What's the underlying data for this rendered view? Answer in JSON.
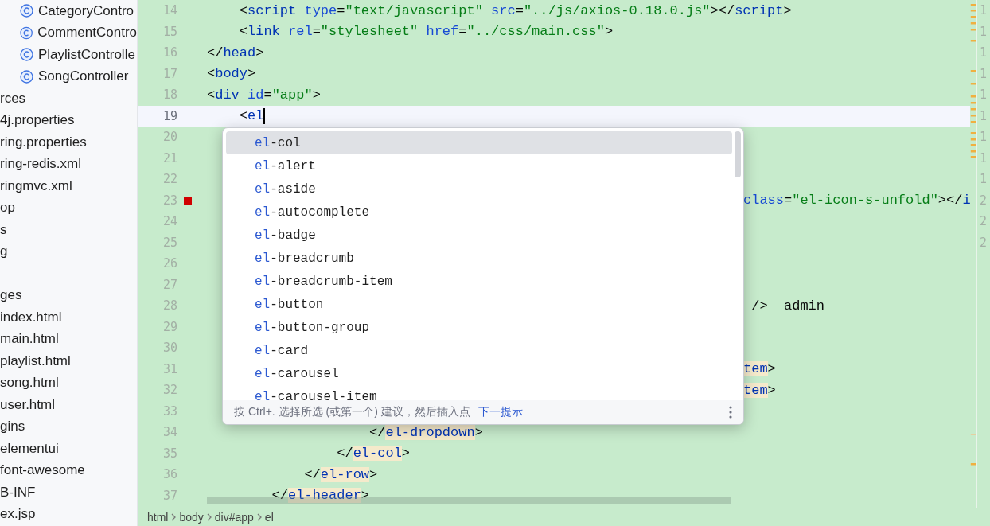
{
  "sidebar": {
    "items": [
      {
        "label": "CategoryContro",
        "kind": "class"
      },
      {
        "label": "CommentContro",
        "kind": "class"
      },
      {
        "label": "PlaylistControlle",
        "kind": "class"
      },
      {
        "label": "SongController",
        "kind": "class"
      },
      {
        "label": "rces",
        "kind": "plain"
      },
      {
        "label": "4j.properties",
        "kind": "plain"
      },
      {
        "label": "ring.properties",
        "kind": "plain"
      },
      {
        "label": "ring-redis.xml",
        "kind": "plain"
      },
      {
        "label": "ringmvc.xml",
        "kind": "plain"
      },
      {
        "label": "op",
        "kind": "plain"
      },
      {
        "label": "s",
        "kind": "plain"
      },
      {
        "label": "g",
        "kind": "plain"
      },
      {
        "kind": "blank"
      },
      {
        "label": "ges",
        "kind": "plain"
      },
      {
        "label": "index.html",
        "kind": "plain"
      },
      {
        "label": "main.html",
        "kind": "plain"
      },
      {
        "label": "playlist.html",
        "kind": "plain"
      },
      {
        "label": "song.html",
        "kind": "plain"
      },
      {
        "label": "user.html",
        "kind": "plain"
      },
      {
        "label": "gins",
        "kind": "plain"
      },
      {
        "label": "elementui",
        "kind": "plain"
      },
      {
        "label": "font-awesome",
        "kind": "plain"
      },
      {
        "label": "B-INF",
        "kind": "plain"
      },
      {
        "label": "ex.jsp",
        "kind": "plain"
      }
    ]
  },
  "editor": {
    "lines": [
      {
        "number": "14",
        "tokens": [
          {
            "kind": "punct",
            "text": "    <"
          },
          {
            "kind": "tag",
            "text": "script"
          },
          {
            "kind": "attr",
            "text": " type"
          },
          {
            "kind": "punct",
            "text": "="
          },
          {
            "kind": "string",
            "text": "\"text/javascript\""
          },
          {
            "kind": "attr",
            "text": " src"
          },
          {
            "kind": "punct",
            "text": "="
          },
          {
            "kind": "string",
            "text": "\"../js/axios-0.18.0.js\""
          },
          {
            "kind": "punct",
            "text": "></"
          },
          {
            "kind": "tag",
            "text": "script"
          },
          {
            "kind": "punct",
            "text": ">"
          }
        ]
      },
      {
        "number": "15",
        "tokens": [
          {
            "kind": "punct",
            "text": "    <"
          },
          {
            "kind": "tag",
            "text": "link"
          },
          {
            "kind": "attr",
            "text": " rel"
          },
          {
            "kind": "punct",
            "text": "="
          },
          {
            "kind": "string",
            "text": "\"stylesheet\""
          },
          {
            "kind": "attr",
            "text": " href"
          },
          {
            "kind": "punct",
            "text": "="
          },
          {
            "kind": "string",
            "text": "\"../css/main.css\""
          },
          {
            "kind": "punct",
            "text": ">"
          }
        ]
      },
      {
        "number": "16",
        "tokens": [
          {
            "kind": "punct",
            "text": "</"
          },
          {
            "kind": "tag",
            "text": "head"
          },
          {
            "kind": "punct",
            "text": ">"
          }
        ]
      },
      {
        "number": "17",
        "tokens": [
          {
            "kind": "punct",
            "text": "<"
          },
          {
            "kind": "tag",
            "text": "body"
          },
          {
            "kind": "punct",
            "text": ">"
          }
        ]
      },
      {
        "number": "18",
        "tokens": [
          {
            "kind": "punct",
            "text": "<"
          },
          {
            "kind": "tag",
            "text": "div"
          },
          {
            "kind": "attr",
            "text": " id"
          },
          {
            "kind": "punct",
            "text": "="
          },
          {
            "kind": "string",
            "text": "\"app\""
          },
          {
            "kind": "punct",
            "text": ">"
          }
        ]
      },
      {
        "number": "19",
        "current": true,
        "tokens": [
          {
            "kind": "punct",
            "text": "    <"
          },
          {
            "kind": "tag",
            "text": "el"
          }
        ]
      },
      {
        "number": "20"
      },
      {
        "number": "21"
      },
      {
        "number": "22"
      },
      {
        "number": "23",
        "error": true,
        "covered": true,
        "tokens": [
          {
            "kind": "attr",
            "text": "class"
          },
          {
            "kind": "punct",
            "text": "="
          },
          {
            "kind": "string",
            "text": "\"el-icon-s-unfold\""
          },
          {
            "kind": "punct",
            "text": "></"
          },
          {
            "kind": "tag",
            "text": "i"
          }
        ]
      },
      {
        "number": "24"
      },
      {
        "number": "25"
      },
      {
        "number": "26"
      },
      {
        "number": "27"
      },
      {
        "number": "28",
        "covered": true,
        "tokens": [
          {
            "kind": "punct",
            "text": " />"
          },
          {
            "kind": "text",
            "text": "  admin"
          }
        ]
      },
      {
        "number": "29"
      },
      {
        "number": "30"
      },
      {
        "number": "31",
        "covered": true,
        "tokens": [
          {
            "kind": "tag",
            "text": "tem",
            "highlight": true
          },
          {
            "kind": "punct",
            "text": ">"
          }
        ]
      },
      {
        "number": "32",
        "covered": true,
        "tokens": [
          {
            "kind": "tag",
            "text": "tem",
            "highlight": true
          },
          {
            "kind": "punct",
            "text": ">"
          }
        ]
      },
      {
        "number": "33"
      },
      {
        "number": "34",
        "tokens": [
          {
            "kind": "punct",
            "text": "                    </"
          },
          {
            "kind": "tag",
            "text": "el-dropdown",
            "highlight": true
          },
          {
            "kind": "punct",
            "text": ">"
          }
        ]
      },
      {
        "number": "35",
        "tokens": [
          {
            "kind": "punct",
            "text": "                </"
          },
          {
            "kind": "tag",
            "text": "el-col",
            "highlight": true
          },
          {
            "kind": "punct",
            "text": ">"
          }
        ]
      },
      {
        "number": "36",
        "tokens": [
          {
            "kind": "punct",
            "text": "            </"
          },
          {
            "kind": "tag",
            "text": "el-row",
            "highlight": true
          },
          {
            "kind": "punct",
            "text": ">"
          }
        ]
      },
      {
        "number": "37",
        "tokens": [
          {
            "kind": "punct",
            "text": "        </"
          },
          {
            "kind": "tag",
            "text": "el-header",
            "highlight": true
          },
          {
            "kind": "punct",
            "text": ">"
          }
        ]
      }
    ],
    "right_gutter": [
      "1",
      "1",
      "1",
      "1",
      "1",
      "1",
      "1",
      "1",
      "1",
      "2",
      "2",
      "2"
    ]
  },
  "completion": {
    "items": [
      {
        "prefix": "el",
        "label": "-col",
        "selected": true
      },
      {
        "prefix": "el",
        "label": "-alert",
        "selected": false
      },
      {
        "prefix": "el",
        "label": "-aside",
        "selected": false
      },
      {
        "prefix": "el",
        "label": "-autocomplete",
        "selected": false
      },
      {
        "prefix": "el",
        "label": "-badge",
        "selected": false
      },
      {
        "prefix": "el",
        "label": "-breadcrumb",
        "selected": false
      },
      {
        "prefix": "el",
        "label": "-breadcrumb-item",
        "selected": false
      },
      {
        "prefix": "el",
        "label": "-button",
        "selected": false
      },
      {
        "prefix": "el",
        "label": "-button-group",
        "selected": false
      },
      {
        "prefix": "el",
        "label": "-card",
        "selected": false
      },
      {
        "prefix": "el",
        "label": "-carousel",
        "selected": false
      },
      {
        "prefix": "el",
        "label": "-carousel-item",
        "selected": false
      }
    ],
    "hint": "按 Ctrl+. 选择所选 (或第一个) 建议，然后插入点",
    "hint_link": "下一提示"
  },
  "breadcrumb": [
    "html",
    "body",
    "div#app",
    "el"
  ]
}
